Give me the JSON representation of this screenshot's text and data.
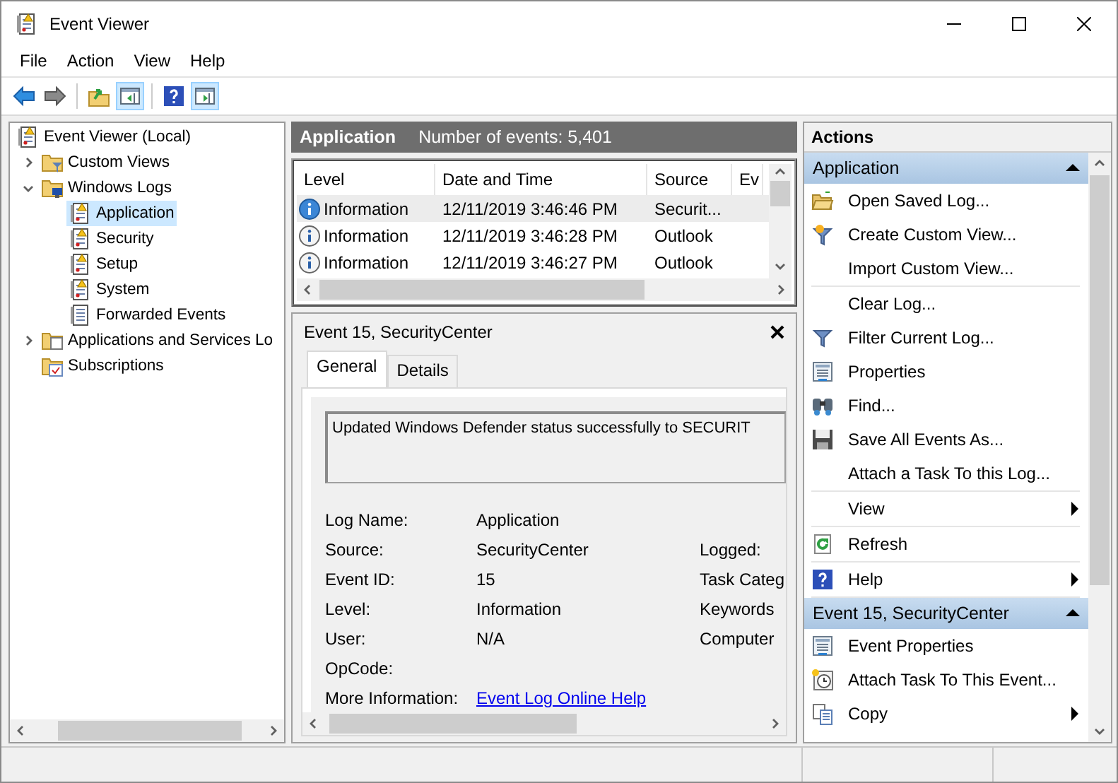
{
  "window": {
    "title": "Event Viewer"
  },
  "menu": [
    {
      "label": "File"
    },
    {
      "label": "Action"
    },
    {
      "label": "View"
    },
    {
      "label": "Help"
    }
  ],
  "toolbar": [
    {
      "kind": "back",
      "on": false
    },
    {
      "kind": "forward",
      "on": false
    },
    {
      "kind": "up",
      "on": false
    },
    {
      "kind": "tree",
      "on": true
    },
    {
      "kind": "help",
      "on": false
    },
    {
      "kind": "actions",
      "on": true
    }
  ],
  "tree": [
    {
      "label": "Event Viewer (Local)",
      "kind": "root",
      "selected": false,
      "children": [
        {
          "label": "Custom Views",
          "kind": "views",
          "expanded": false,
          "selected": false
        },
        {
          "label": "Windows Logs",
          "kind": "logs",
          "expanded": true,
          "selected": false,
          "children": [
            {
              "label": "Application",
              "kind": "log",
              "selected": true
            },
            {
              "label": "Security",
              "kind": "log",
              "selected": false
            },
            {
              "label": "Setup",
              "kind": "log",
              "selected": false
            },
            {
              "label": "System",
              "kind": "log",
              "selected": false
            },
            {
              "label": "Forwarded Events",
              "kind": "page",
              "selected": false
            }
          ]
        },
        {
          "label": "Applications and Services Lo",
          "kind": "folder",
          "expanded": false,
          "selected": false
        },
        {
          "label": "Subscriptions",
          "kind": "subscriptions",
          "selected": false
        }
      ]
    }
  ],
  "log_header": {
    "title": "Application",
    "count": "Number of events: 5,401"
  },
  "events": {
    "columns": [
      "Level",
      "Date and Time",
      "Source",
      "Ev"
    ],
    "rows": [
      {
        "level": "Information",
        "date": "12/11/2019 3:46:46 PM",
        "source": "Securit...",
        "selected": true
      },
      {
        "level": "Information",
        "date": "12/11/2019 3:46:28 PM",
        "source": "Outlook",
        "selected": false
      },
      {
        "level": "Information",
        "date": "12/11/2019 3:46:27 PM",
        "source": "Outlook",
        "selected": false
      }
    ]
  },
  "detail": {
    "title": "Event 15, SecurityCenter",
    "tabs": [
      {
        "label": "General",
        "selected": true
      },
      {
        "label": "Details",
        "selected": false
      }
    ],
    "message": "Updated Windows Defender status successfully to SECURIT",
    "fields": [
      {
        "label": "Log Name:",
        "value": "Application"
      },
      {
        "label": "Source:",
        "value": "SecurityCenter",
        "label_2": "Logged:"
      },
      {
        "label": "Event ID:",
        "value": "15",
        "label_2": "Task Categ"
      },
      {
        "label": "Level:",
        "value": "Information",
        "label_2": "Keywords"
      },
      {
        "label": "User:",
        "value": "N/A",
        "label_2": "Computer"
      },
      {
        "label": "OpCode:"
      }
    ],
    "more_info": {
      "label": "More Information:",
      "link": "Event Log Online Help"
    }
  },
  "actions": {
    "title": "Actions",
    "sections": [
      {
        "title": "Application",
        "expanded": true,
        "groups": [
          [
            {
              "label": "Open Saved Log...",
              "kind": "open",
              "submenu": false
            },
            {
              "label": "Create Custom View...",
              "kind": "create",
              "submenu": false
            },
            {
              "label": "Import Custom View...",
              "kind": "plain",
              "submenu": false
            }
          ],
          [
            {
              "label": "Clear Log...",
              "kind": "plain",
              "submenu": false
            },
            {
              "label": "Filter Current Log...",
              "kind": "filter",
              "submenu": false
            },
            {
              "label": "Properties",
              "kind": "properties",
              "submenu": false
            },
            {
              "label": "Find...",
              "kind": "find",
              "submenu": false
            },
            {
              "label": "Save All Events As...",
              "kind": "save",
              "submenu": false
            },
            {
              "label": "Attach a Task To this Log...",
              "kind": "plain",
              "submenu": false
            }
          ],
          [
            {
              "label": "View",
              "kind": "plain",
              "submenu": true
            }
          ],
          [
            {
              "label": "Refresh",
              "kind": "refresh",
              "submenu": false
            }
          ],
          [
            {
              "label": "Help",
              "kind": "help",
              "submenu": true
            }
          ]
        ]
      },
      {
        "title": "Event 15, SecurityCenter",
        "expanded": true,
        "groups": [
          [
            {
              "label": "Event Properties",
              "kind": "properties",
              "submenu": false
            },
            {
              "label": "Attach Task To This Event...",
              "kind": "task",
              "submenu": false
            },
            {
              "label": "Copy",
              "kind": "copy",
              "submenu": true
            }
          ]
        ]
      }
    ]
  }
}
